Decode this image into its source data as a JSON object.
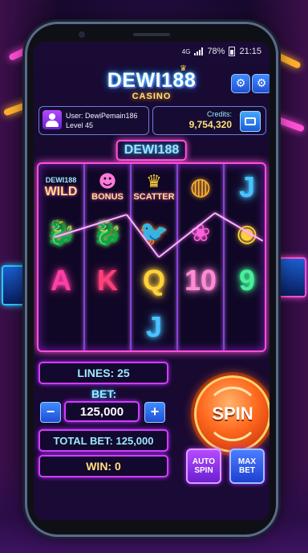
{
  "status": {
    "signal": "4G",
    "battery": "78%",
    "time": "21:15"
  },
  "header": {
    "logo_main": "DEWI188",
    "logo_sub": "CASINO",
    "settings_icon": "gear-icon",
    "options_icon": "gear-icon"
  },
  "user": {
    "label_user": "User: DewiPemain186",
    "label_level": "Level 45"
  },
  "credits": {
    "label": "Credits:",
    "value": "9,754,320",
    "icon": "wallet-icon"
  },
  "game_logo": "DEWI188",
  "reels": [
    [
      {
        "type": "label",
        "sub": "DEWI188",
        "text": "WILD"
      },
      {
        "type": "art",
        "icon": "dragon-icon"
      },
      {
        "type": "letter",
        "text": "A"
      },
      {
        "type": "letter",
        "text": ""
      }
    ],
    [
      {
        "type": "label",
        "text": "BONUS"
      },
      {
        "type": "art",
        "icon": "dragon-icon"
      },
      {
        "type": "letter",
        "text": "K"
      },
      {
        "type": "letter",
        "text": ""
      }
    ],
    [
      {
        "type": "label",
        "text": "SCATTER"
      },
      {
        "type": "art",
        "icon": "phoenix-icon"
      },
      {
        "type": "letter",
        "text": "Q"
      },
      {
        "type": "letter",
        "text": "J"
      }
    ],
    [
      {
        "type": "art",
        "icon": "lantern-icon"
      },
      {
        "type": "art",
        "icon": "lotus-icon"
      },
      {
        "type": "letter",
        "text": "10"
      },
      {
        "type": "letter",
        "text": ""
      }
    ],
    [
      {
        "type": "letter",
        "text": "J"
      },
      {
        "type": "art",
        "icon": "coins-icon"
      },
      {
        "type": "letter",
        "text": "9"
      },
      {
        "type": "letter",
        "text": ""
      }
    ]
  ],
  "controls": {
    "lines": "LINES: 25",
    "bet_label": "BET:",
    "bet_value": "125,000",
    "minus": "−",
    "plus": "+",
    "total_bet": "TOTAL BET: 125,000",
    "win": "WIN: 0",
    "spin": "SPIN",
    "auto_spin_1": "AUTO",
    "auto_spin_2": "SPIN",
    "max_bet_1": "MAX",
    "max_bet_2": "BET"
  },
  "colors": {
    "neon_pink": "#ff4fd8",
    "neon_cyan": "#9de9ff",
    "gold": "#ffe27a",
    "spin_orange": "#ff6a1f"
  }
}
